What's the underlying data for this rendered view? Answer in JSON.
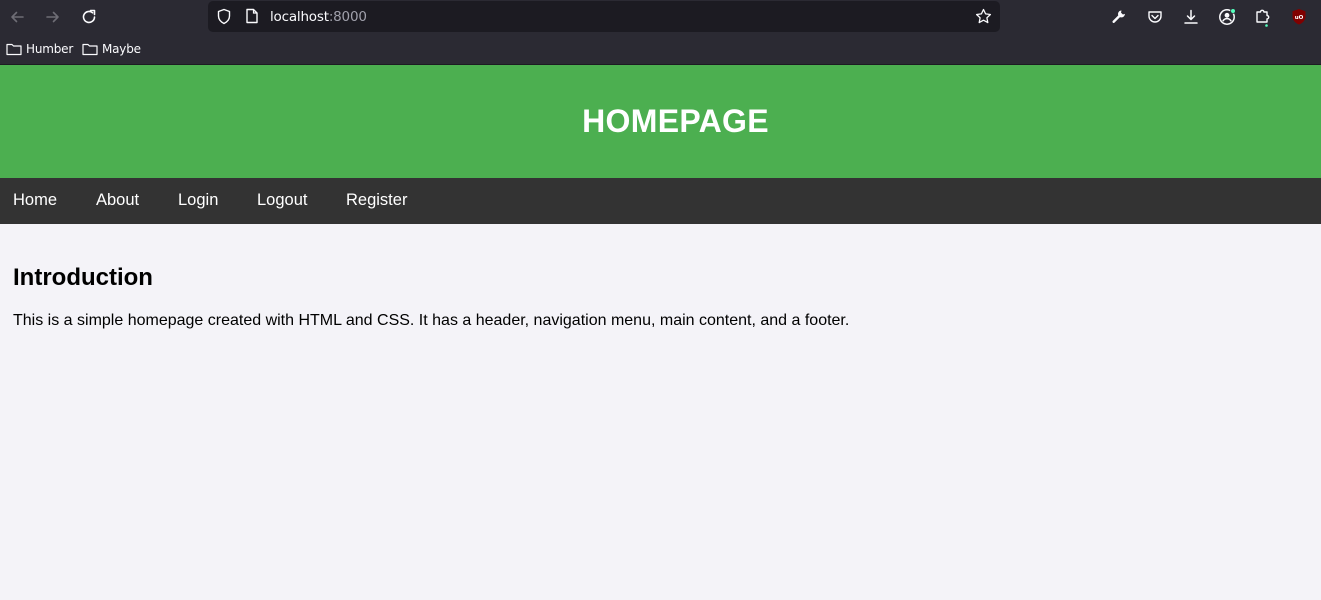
{
  "browser": {
    "url_host": "localhost",
    "url_port": ":8000",
    "bookmarks": [
      {
        "label": "Humber"
      },
      {
        "label": "Maybe"
      }
    ]
  },
  "page": {
    "header_title": "HOMEPAGE",
    "nav": [
      {
        "label": "Home"
      },
      {
        "label": "About"
      },
      {
        "label": "Login"
      },
      {
        "label": "Logout"
      },
      {
        "label": "Register"
      }
    ],
    "main": {
      "heading": "Introduction",
      "paragraph": "This is a simple homepage created with HTML and CSS. It has a header, navigation menu, main content, and a footer."
    }
  },
  "colors": {
    "header_bg": "#4caf50",
    "nav_bg": "#333333",
    "page_bg": "#f4f3f8",
    "chrome_bg": "#2b2a33"
  }
}
